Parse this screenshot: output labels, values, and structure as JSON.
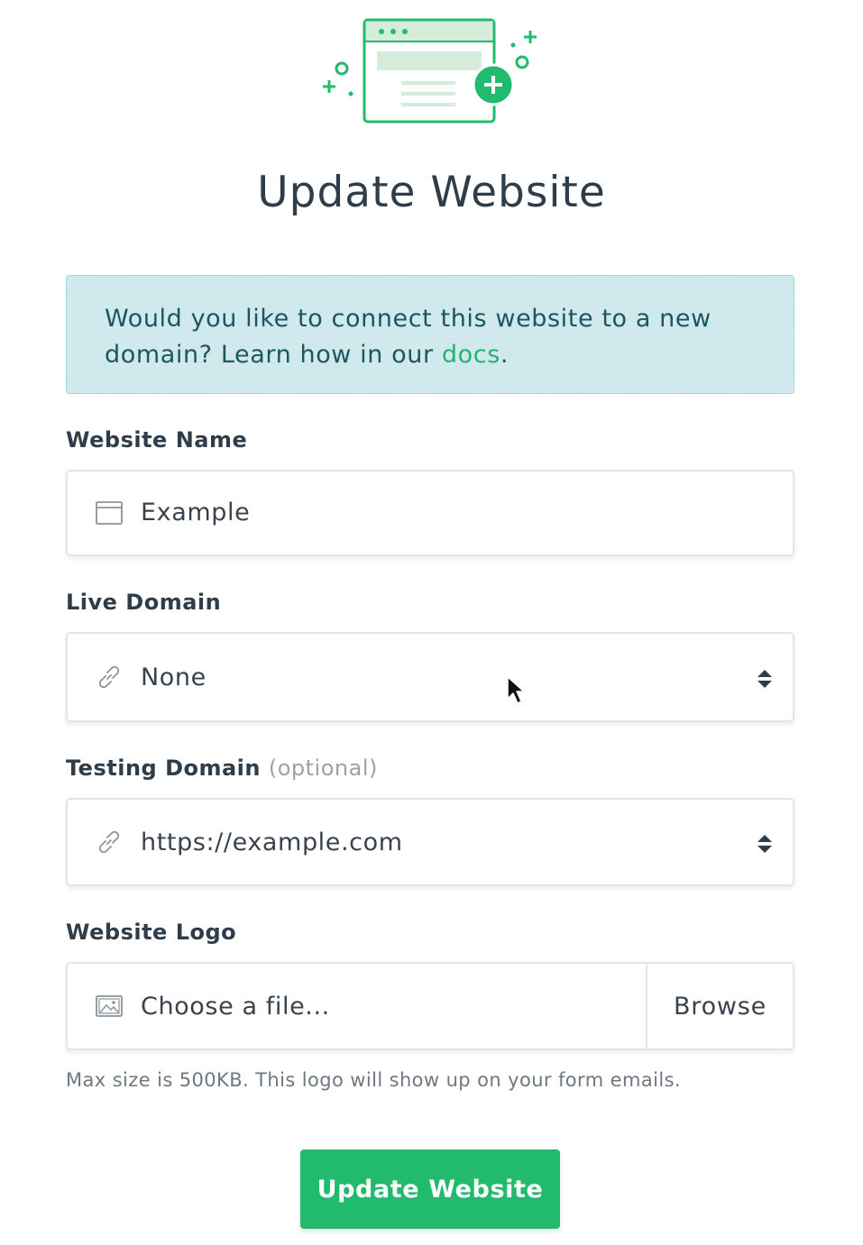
{
  "page": {
    "title": "Update Website",
    "illustration_icon": "website-add-illustration",
    "accent_color": "#22bb6e"
  },
  "banner": {
    "text_before_link": "Would you like to connect this website to a new domain? Learn how in our ",
    "link_text": "docs",
    "text_after_link": ".",
    "background_color": "#cde8ec"
  },
  "fields": {
    "website_name": {
      "label": "Website Name",
      "value": "Example",
      "icon": "browser-window-icon"
    },
    "live_domain": {
      "label": "Live Domain",
      "selected": "None",
      "icon": "link-icon"
    },
    "testing_domain": {
      "label": "Testing Domain",
      "optional_note": "(optional)",
      "selected": "https://example.com",
      "icon": "link-icon"
    },
    "website_logo": {
      "label": "Website Logo",
      "placeholder": "Choose a file...",
      "browse_label": "Browse",
      "icon": "image-icon",
      "help": "Max size is 500KB. This logo will show up on your form emails."
    }
  },
  "actions": {
    "submit_label": "Update Website"
  }
}
